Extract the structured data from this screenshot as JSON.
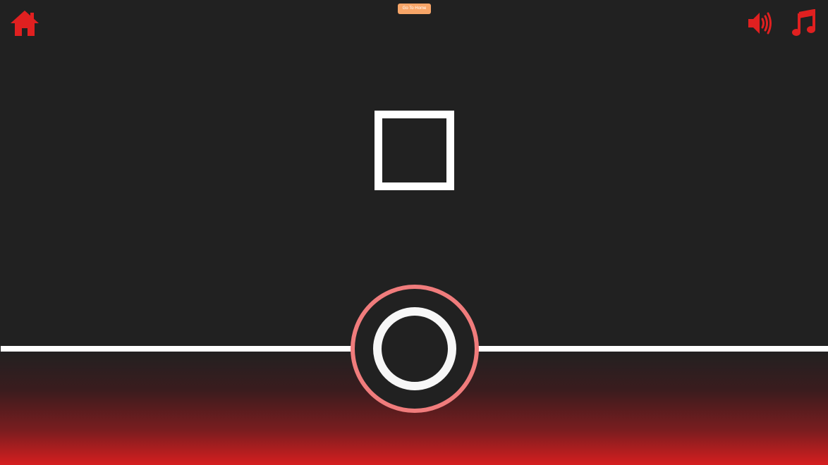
{
  "header": {
    "go_home_label": "Go To Home",
    "home_icon": "home-icon",
    "sound_icon": "volume-icon",
    "music_icon": "music-note-icon"
  },
  "game": {
    "target_shape": "square",
    "player_shape": "circle"
  },
  "colors": {
    "background": "#212121",
    "accent": "#e02020",
    "ring": "#f07c7c",
    "button": "#f7a568",
    "line": "#ffffff"
  }
}
